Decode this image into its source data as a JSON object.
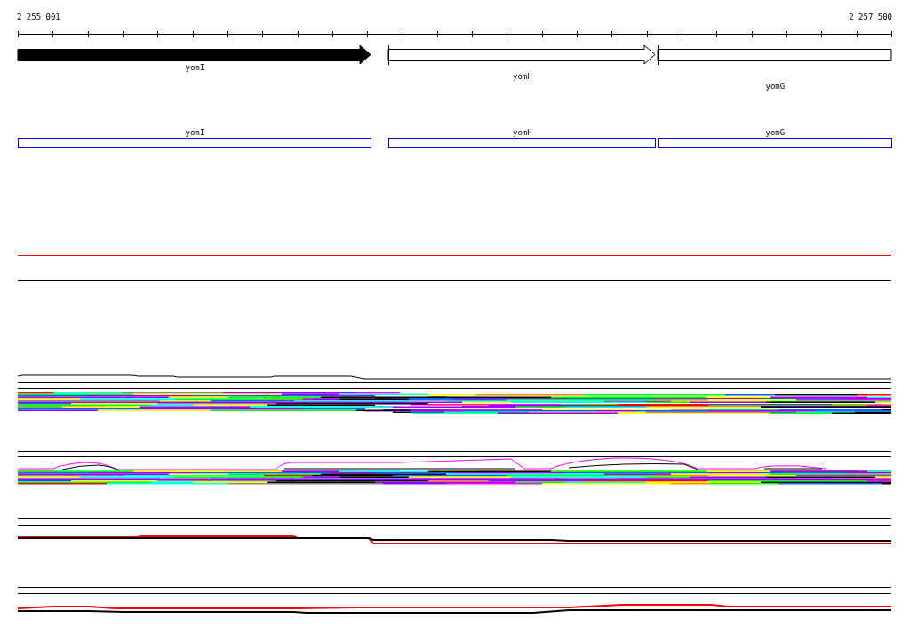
{
  "ruler": {
    "start_label": "2 255 001",
    "end_label": "2 257 500"
  },
  "genes": [
    {
      "name": "yomI",
      "kind": "arrow",
      "filled": true
    },
    {
      "name": "yomH",
      "kind": "arrow",
      "filled": false
    },
    {
      "name": "yomG",
      "kind": "box",
      "filled": false
    }
  ],
  "annotations": [
    {
      "name": "yomI"
    },
    {
      "name": "yomH"
    },
    {
      "name": "yomG"
    }
  ]
}
